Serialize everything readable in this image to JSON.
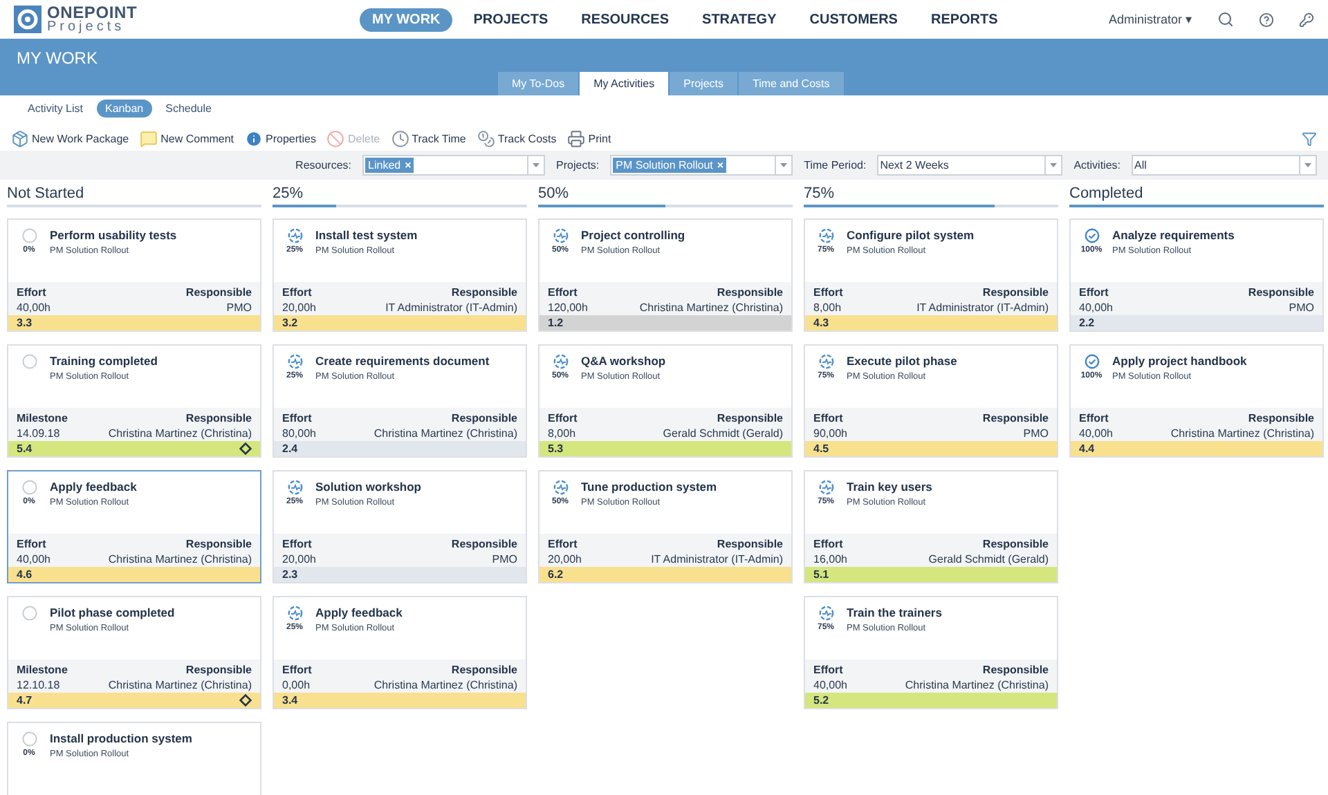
{
  "logo": {
    "name": "ONEPOINT",
    "sub": "Projects"
  },
  "nav": [
    {
      "label": "MY WORK",
      "selected": true
    },
    {
      "label": "PROJECTS",
      "selected": false
    },
    {
      "label": "RESOURCES",
      "selected": false
    },
    {
      "label": "STRATEGY",
      "selected": false
    },
    {
      "label": "CUSTOMERS",
      "selected": false
    },
    {
      "label": "REPORTS",
      "selected": false
    }
  ],
  "user": {
    "label": "Administrator",
    "caret": "▾"
  },
  "header": {
    "title": "MY WORK"
  },
  "tabs": [
    {
      "label": "My To-Dos",
      "selected": false
    },
    {
      "label": "My Activities",
      "selected": true
    },
    {
      "label": "Projects",
      "selected": false
    },
    {
      "label": "Time and Costs",
      "selected": false
    }
  ],
  "views": [
    {
      "label": "Activity List",
      "selected": false
    },
    {
      "label": "Kanban",
      "selected": true
    },
    {
      "label": "Schedule",
      "selected": false
    }
  ],
  "toolbar": [
    {
      "kind": "package",
      "label": "New Work Package",
      "disabled": false
    },
    {
      "kind": "comment",
      "label": "New Comment",
      "disabled": false
    },
    {
      "kind": "info",
      "label": "Properties",
      "disabled": false
    },
    {
      "kind": "delete",
      "label": "Delete",
      "disabled": true
    },
    {
      "kind": "time",
      "label": "Track Time",
      "disabled": false
    },
    {
      "kind": "costs",
      "label": "Track Costs",
      "disabled": false
    },
    {
      "kind": "print",
      "label": "Print",
      "disabled": false
    }
  ],
  "filters": [
    {
      "label": "Resources:",
      "tag": "Linked",
      "tag_close": "×"
    },
    {
      "label": "Projects:",
      "tag": "PM Solution Rollout",
      "tag_close": "×"
    },
    {
      "label": "Time Period:",
      "value": "Next 2 Weeks"
    },
    {
      "label": "Activities:",
      "value": "All"
    }
  ],
  "columns": [
    {
      "title": "Not Started",
      "level": 0,
      "cards": [
        {
          "kind": "not-started",
          "title": "Perform usability tests",
          "project": "PM Solution Rollout",
          "percent": "0%",
          "detail_label": "Effort",
          "detail": "40,00h",
          "resp_label": "Responsible",
          "responsible": "PMO",
          "code": "3.3",
          "color": "#f8e08e",
          "milestone": false,
          "selected": false
        },
        {
          "kind": "not-started",
          "title": "Training completed",
          "project": "PM Solution Rollout",
          "detail_label": "Milestone",
          "detail": "14.09.18",
          "resp_label": "Responsible",
          "responsible": "Christina Martinez (Christina)",
          "code": "5.4",
          "color": "#d5e67f",
          "milestone": true,
          "selected": false
        },
        {
          "kind": "not-started",
          "title": "Apply feedback",
          "project": "PM Solution Rollout",
          "percent": "0%",
          "detail_label": "Effort",
          "detail": "40,00h",
          "resp_label": "Responsible",
          "responsible": "Christina Martinez (Christina)",
          "code": "4.6",
          "color": "#f8e08e",
          "milestone": false,
          "selected": true
        },
        {
          "kind": "not-started",
          "title": "Pilot phase completed",
          "project": "PM Solution Rollout",
          "detail_label": "Milestone",
          "detail": "12.10.18",
          "resp_label": "Responsible",
          "responsible": "Christina Martinez (Christina)",
          "code": "4.7",
          "color": "#f8e08e",
          "milestone": true,
          "selected": false
        },
        {
          "kind": "not-started",
          "title": "Install production system",
          "project": "PM Solution Rollout",
          "percent": "0%",
          "selected": false
        }
      ]
    },
    {
      "title": "25%",
      "level": 0.25,
      "cards": [
        {
          "kind": "in-progress",
          "title": "Install test system",
          "project": "PM Solution Rollout",
          "percent": "25%",
          "detail_label": "Effort",
          "detail": "20,00h",
          "resp_label": "Responsible",
          "responsible": "IT Administrator (IT-Admin)",
          "code": "3.2",
          "color": "#f8e08e",
          "milestone": false,
          "selected": false
        },
        {
          "kind": "in-progress",
          "title": "Create requirements document",
          "project": "PM Solution Rollout",
          "percent": "25%",
          "detail_label": "Effort",
          "detail": "80,00h",
          "resp_label": "Responsible",
          "responsible": "Christina Martinez (Christina)",
          "code": "2.4",
          "color": "#e2e7ed",
          "milestone": false,
          "selected": false
        },
        {
          "kind": "in-progress",
          "title": "Solution workshop",
          "project": "PM Solution Rollout",
          "percent": "25%",
          "detail_label": "Effort",
          "detail": "20,00h",
          "resp_label": "Responsible",
          "responsible": "PMO",
          "code": "2.3",
          "color": "#e2e7ed",
          "milestone": false,
          "selected": false
        },
        {
          "kind": "in-progress",
          "title": "Apply feedback",
          "project": "PM Solution Rollout",
          "percent": "25%",
          "detail_label": "Effort",
          "detail": "0,00h",
          "resp_label": "Responsible",
          "responsible": "Christina Martinez (Christina)",
          "code": "3.4",
          "color": "#f8e08e",
          "milestone": false,
          "selected": false
        }
      ]
    },
    {
      "title": "50%",
      "level": 0.5,
      "cards": [
        {
          "kind": "in-progress",
          "title": "Project controlling",
          "project": "PM Solution Rollout",
          "percent": "50%",
          "detail_label": "Effort",
          "detail": "120,00h",
          "resp_label": "Responsible",
          "responsible": "Christina Martinez (Christina)",
          "code": "1.2",
          "color": "#d3d3d3",
          "milestone": false,
          "selected": false
        },
        {
          "kind": "in-progress",
          "title": "Q&A workshop",
          "project": "PM Solution Rollout",
          "percent": "50%",
          "detail_label": "Effort",
          "detail": "8,00h",
          "resp_label": "Responsible",
          "responsible": "Gerald Schmidt (Gerald)",
          "code": "5.3",
          "color": "#d5e67f",
          "milestone": false,
          "selected": false
        },
        {
          "kind": "in-progress",
          "title": "Tune production system",
          "project": "PM Solution Rollout",
          "percent": "50%",
          "detail_label": "Effort",
          "detail": "20,00h",
          "resp_label": "Responsible",
          "responsible": "IT Administrator (IT-Admin)",
          "code": "6.2",
          "color": "#f8e08e",
          "milestone": false,
          "selected": false
        }
      ]
    },
    {
      "title": "75%",
      "level": 0.75,
      "cards": [
        {
          "kind": "in-progress",
          "title": "Configure pilot system",
          "project": "PM Solution Rollout",
          "percent": "75%",
          "detail_label": "Effort",
          "detail": "8,00h",
          "resp_label": "Responsible",
          "responsible": "IT Administrator (IT-Admin)",
          "code": "4.3",
          "color": "#f8e08e",
          "milestone": false,
          "selected": false
        },
        {
          "kind": "in-progress",
          "title": "Execute pilot phase",
          "project": "PM Solution Rollout",
          "percent": "75%",
          "detail_label": "Effort",
          "detail": "90,00h",
          "resp_label": "Responsible",
          "responsible": "PMO",
          "code": "4.5",
          "color": "#f8e08e",
          "milestone": false,
          "selected": false
        },
        {
          "kind": "in-progress",
          "title": "Train key users",
          "project": "PM Solution Rollout",
          "percent": "75%",
          "detail_label": "Effort",
          "detail": "16,00h",
          "resp_label": "Responsible",
          "responsible": "Gerald Schmidt (Gerald)",
          "code": "5.1",
          "color": "#d5e67f",
          "milestone": false,
          "selected": false
        },
        {
          "kind": "in-progress",
          "title": "Train the trainers",
          "project": "PM Solution Rollout",
          "percent": "75%",
          "detail_label": "Effort",
          "detail": "40,00h",
          "resp_label": "Responsible",
          "responsible": "Christina Martinez (Christina)",
          "code": "5.2",
          "color": "#d5e67f",
          "milestone": false,
          "selected": false
        }
      ]
    },
    {
      "title": "Completed",
      "level": 1,
      "cards": [
        {
          "kind": "done",
          "title": "Analyze requirements",
          "project": "PM Solution Rollout",
          "percent": "100%",
          "detail_label": "Effort",
          "detail": "40,00h",
          "resp_label": "Responsible",
          "responsible": "PMO",
          "code": "2.2",
          "color": "#e2e7ed",
          "milestone": false,
          "selected": false
        },
        {
          "kind": "done",
          "title": "Apply project handbook",
          "project": "PM Solution Rollout",
          "percent": "100%",
          "detail_label": "Effort",
          "detail": "40,00h",
          "resp_label": "Responsible",
          "responsible": "Christina Martinez (Christina)",
          "code": "4.4",
          "color": "#f8e08e",
          "milestone": false,
          "selected": false
        }
      ]
    }
  ]
}
